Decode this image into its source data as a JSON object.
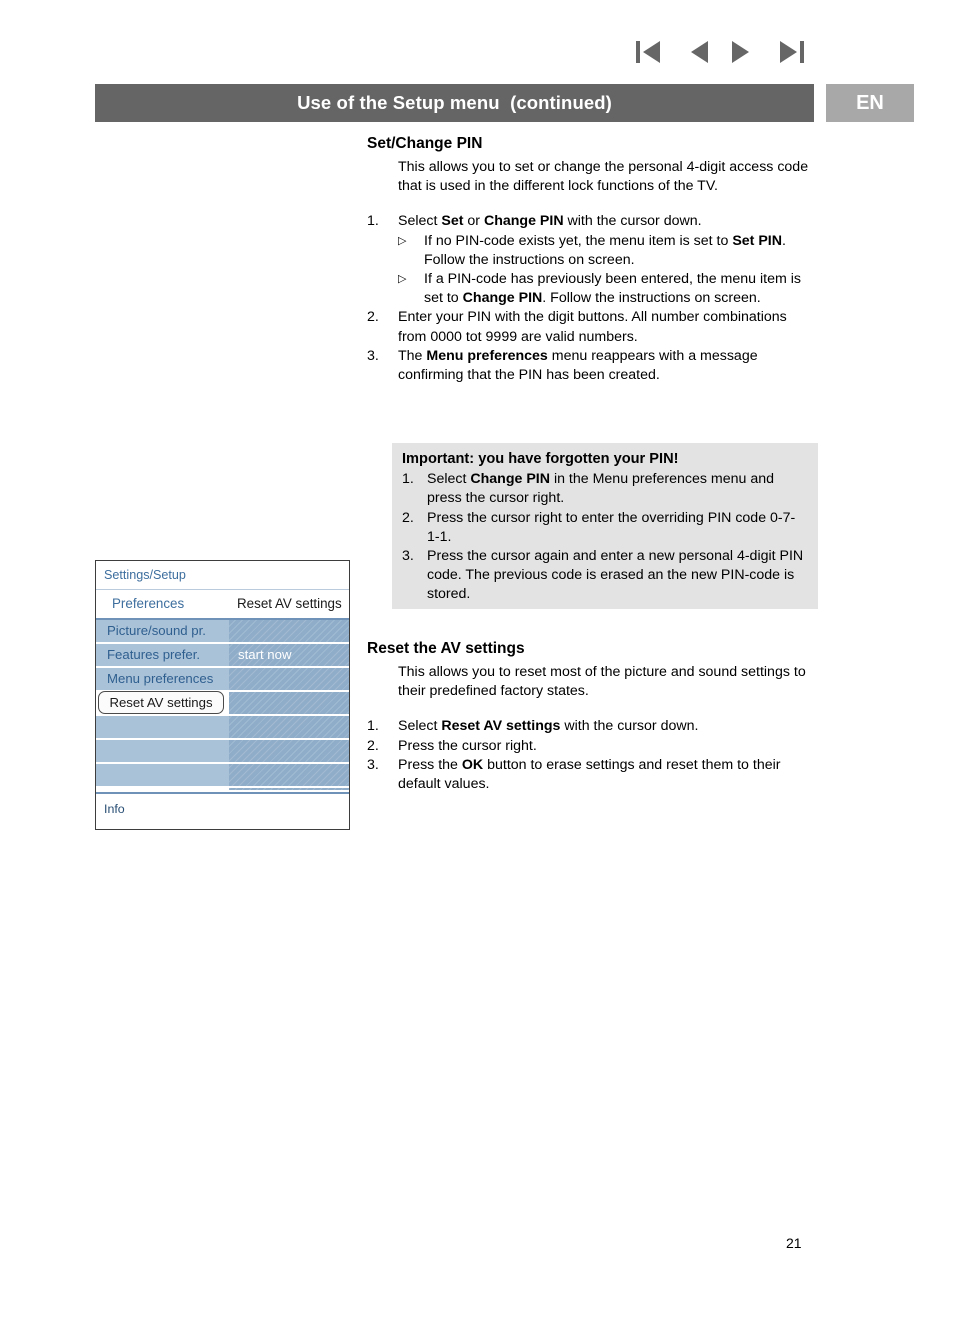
{
  "nav": {
    "icons": [
      {
        "name": "first-page-icon",
        "glyph": "|◀"
      },
      {
        "name": "previous-page-icon",
        "glyph": "◀"
      },
      {
        "name": "next-page-icon",
        "glyph": "▶"
      },
      {
        "name": "last-page-icon",
        "glyph": "▶|"
      }
    ]
  },
  "header": {
    "title": "Use of the Setup menu  (continued)",
    "language_badge": "EN",
    "bar_color": "#656565",
    "badge_color": "#a8a8a8"
  },
  "sections": {
    "pin": {
      "title": "Set/Change PIN",
      "intro": "This allows you to set or change the personal 4-digit access code that is used in the different lock functions of the TV.",
      "steps": [
        {
          "num": "1.",
          "text_parts": [
            {
              "t": "Select "
            },
            {
              "t": "Set",
              "b": true
            },
            {
              "t": " or "
            },
            {
              "t": "Change PIN",
              "b": true
            },
            {
              "t": " with the cursor down."
            }
          ],
          "bullets": [
            {
              "marker": "▷",
              "parts": [
                {
                  "t": "If no PIN-code exists yet, the menu item is set to "
                },
                {
                  "t": "Set PIN",
                  "b": true
                },
                {
                  "t": ". Follow the instructions on screen."
                }
              ]
            },
            {
              "marker": "▷",
              "parts": [
                {
                  "t": "If a PIN-code has previously been entered, the menu item is set to "
                },
                {
                  "t": "Change PIN",
                  "b": true
                },
                {
                  "t": ". Follow the instructions on screen."
                }
              ]
            }
          ]
        },
        {
          "num": "2.",
          "text_parts": [
            {
              "t": "Enter your PIN with the digit buttons.\nAll number combinations from 0000 tot 9999 are valid numbers."
            }
          ],
          "bullets": []
        },
        {
          "num": "3.",
          "text_parts": [
            {
              "t": "The "
            },
            {
              "t": "Menu preferences",
              "b": true
            },
            {
              "t": " menu reappears with a message confirming that the PIN has been created."
            }
          ],
          "bullets": []
        }
      ]
    },
    "important": {
      "title": "Important: you have forgotten your PIN!",
      "background_color": "#e3e3e3",
      "steps": [
        {
          "num": "1.",
          "parts": [
            {
              "t": "Select "
            },
            {
              "t": "Change PIN",
              "b": true
            },
            {
              "t": " in the Menu preferences menu and press the cursor right."
            }
          ]
        },
        {
          "num": "2.",
          "parts": [
            {
              "t": "Press the cursor right to enter the overriding PIN code 0-7-1-1."
            }
          ]
        },
        {
          "num": "3.",
          "parts": [
            {
              "t": "Press the cursor again and enter a new personal 4-digit PIN code. The previous code is erased an the new PIN-code is stored."
            }
          ]
        }
      ]
    },
    "reset": {
      "title": "Reset the AV settings",
      "intro": "This allows you to reset most of the picture and sound settings to their predefined factory states.",
      "steps": [
        {
          "num": "1.",
          "parts": [
            {
              "t": "Select "
            },
            {
              "t": "Reset AV settings",
              "b": true
            },
            {
              "t": " with the cursor down."
            }
          ]
        },
        {
          "num": "2.",
          "parts": [
            {
              "t": "Press the cursor right."
            }
          ]
        },
        {
          "num": "3.",
          "parts": [
            {
              "t": "Press the "
            },
            {
              "t": "OK",
              "b": true
            },
            {
              "t": " button to erase settings and reset them to their default values."
            }
          ]
        }
      ]
    }
  },
  "tv_menu": {
    "breadcrumb": "Settings/Setup",
    "column_header_left": "Preferences",
    "column_header_right": "Reset AV settings",
    "left_items": [
      {
        "label": "Picture/sound pr.",
        "selected": false
      },
      {
        "label": "Features prefer.",
        "selected": false
      },
      {
        "label": "Menu preferences",
        "selected": false
      },
      {
        "label": "Reset AV settings",
        "selected": true
      },
      {
        "label": "",
        "selected": false
      },
      {
        "label": "",
        "selected": false
      },
      {
        "label": "",
        "selected": false
      }
    ],
    "right_items": [
      "",
      "start now",
      "",
      "",
      "",
      "",
      ""
    ],
    "info_label": "Info",
    "colors": {
      "row": "#aac2d8",
      "panel": "#8fadc9",
      "link_text": "#3d6e9e"
    }
  },
  "footer": {
    "page_number": "21"
  }
}
